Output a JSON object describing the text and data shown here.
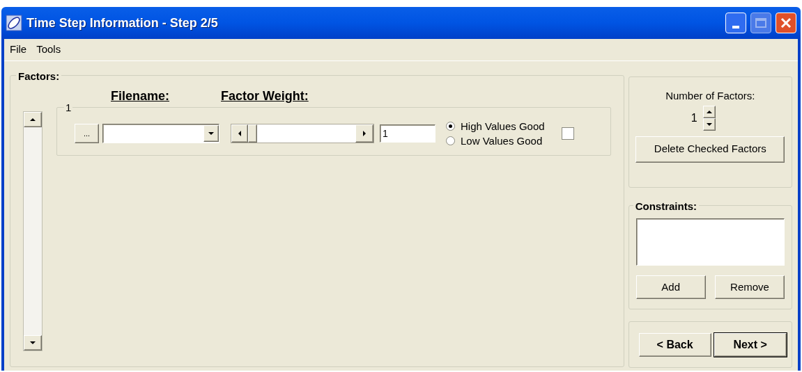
{
  "window": {
    "title": "Time Step Information - Step 2/5"
  },
  "menu": [
    "File",
    "Tools"
  ],
  "factors": {
    "title": "Factors:",
    "headers": [
      "Filename:",
      "Factor Weight:"
    ],
    "rows": [
      {
        "label": "1",
        "browse": "...",
        "filename": "",
        "weight": {
          "level": 0
        },
        "value": "1",
        "options": [
          {
            "label": "High Values Good",
            "selected": true
          },
          {
            "label": "Low Values Good",
            "selected": false
          }
        ],
        "checked": false
      }
    ]
  },
  "count": {
    "label": "Number of Factors:",
    "value": "1",
    "delete_button": "Delete Checked Factors"
  },
  "constraints": {
    "title": "Constraints:",
    "add": "Add",
    "remove": "Remove"
  },
  "nav": {
    "back": "< Back",
    "next": "Next >"
  }
}
